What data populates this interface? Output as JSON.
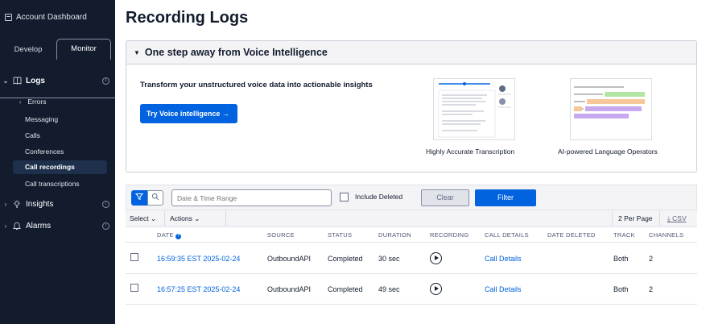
{
  "sidebar": {
    "header": "Account Dashboard",
    "tabs": {
      "develop": "Develop",
      "monitor": "Monitor"
    },
    "logs_label": "Logs",
    "logs_children": {
      "errors": "Errors",
      "messaging": "Messaging",
      "calls": "Calls",
      "conferences": "Conferences",
      "call_recordings": "Call recordings",
      "call_transcriptions": "Call transcriptions"
    },
    "insights_label": "Insights",
    "alarms_label": "Alarms",
    "active_item": "Call recordings"
  },
  "page": {
    "title": "Recording Logs"
  },
  "voice_intel": {
    "heading": "One step away from Voice Intelligence",
    "tagline": "Transform your unstructured voice data into actionable insights",
    "button": "Try Voice intelligence →",
    "feature1_caption": "Highly Accurate Transcription",
    "feature2_caption": "AI-powered Language Operators"
  },
  "filters": {
    "date_placeholder": "Date & Time Range",
    "include_deleted_label": "Include Deleted",
    "include_deleted_checked": false,
    "clear_label": "Clear",
    "apply_label": "Filter"
  },
  "actions": {
    "select_label": "Select",
    "actions_label": "Actions",
    "per_page": "2 Per Page",
    "csv": "CSV"
  },
  "table": {
    "columns": {
      "date": "DATE",
      "source": "SOURCE",
      "status": "STATUS",
      "duration": "DURATION",
      "recording": "RECORDING",
      "call_details": "CALL DETAILS",
      "date_deleted": "DATE DELETED",
      "track": "TRACK",
      "channels": "CHANNELS"
    },
    "rows": [
      {
        "date": "16:59:35 EST 2025-02-24",
        "source": "OutboundAPI",
        "status": "Completed",
        "duration": "30 sec",
        "call_details": "Call Details",
        "date_deleted": "",
        "track": "Both",
        "channels": "2"
      },
      {
        "date": "16:57:25 EST 2025-02-24",
        "source": "OutboundAPI",
        "status": "Completed",
        "duration": "49 sec",
        "call_details": "Call Details",
        "date_deleted": "",
        "track": "Both",
        "channels": "2"
      }
    ]
  },
  "colors": {
    "primary": "#0263e0",
    "sidebar_bg": "#121c2d",
    "active_nav_bg": "#1f304c"
  }
}
